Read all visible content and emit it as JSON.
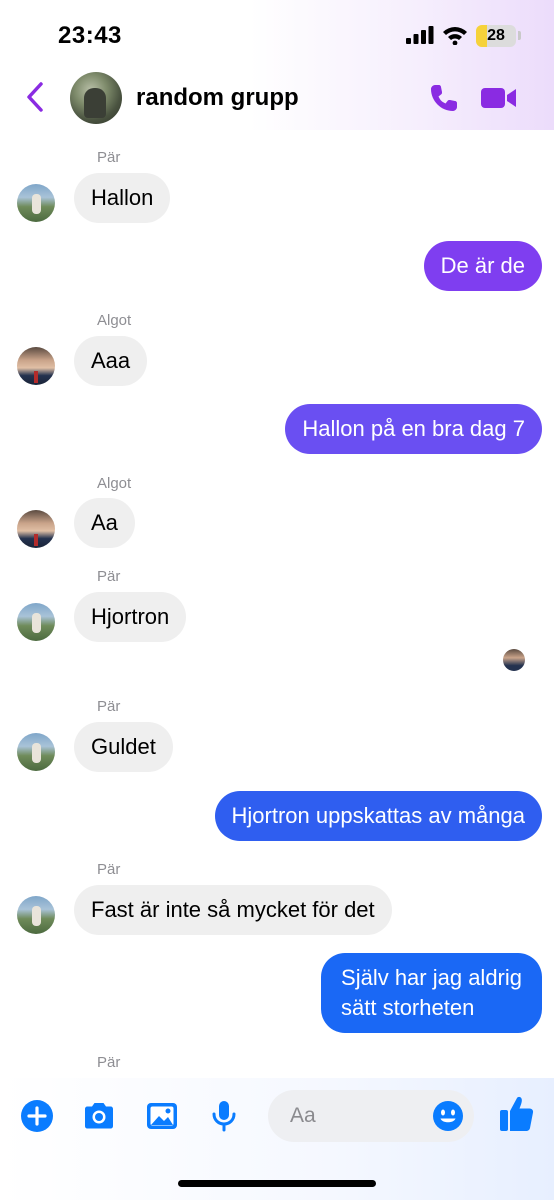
{
  "status_bar": {
    "time": "23:43",
    "battery": "28",
    "battery_level": 0.28
  },
  "header": {
    "title": "random grupp"
  },
  "colors": {
    "accent_purple": "#8a2be2",
    "accent_blue": "#0a7cff"
  },
  "messages": [
    {
      "sender": "Pär",
      "text": "Hallon",
      "direction": "in"
    },
    {
      "text": "De är de",
      "direction": "out"
    },
    {
      "sender": "Algot",
      "text": "Aaa",
      "direction": "in"
    },
    {
      "text": "Hallon på en bra dag 7",
      "direction": "out"
    },
    {
      "sender": "Algot",
      "text": "Aa",
      "direction": "in"
    },
    {
      "sender": "Pär",
      "text": "Hjortron",
      "direction": "in"
    },
    {
      "sender": "Pär",
      "text": "Guldet",
      "direction": "in"
    },
    {
      "text": "Hjortron uppskattas av många",
      "direction": "out"
    },
    {
      "sender": "Pär",
      "text": "Fast är inte så mycket för det",
      "direction": "in"
    },
    {
      "text_lines": [
        "Själv har jag aldrig",
        "sätt storheten"
      ],
      "direction": "out"
    },
    {
      "sender": "Pär"
    }
  ],
  "composer": {
    "placeholder": "Aa"
  },
  "icons": [
    "back-chevron-icon",
    "phone-icon",
    "video-camera-icon",
    "plus-icon",
    "camera-icon",
    "image-icon",
    "microphone-icon",
    "emoji-icon",
    "thumbs-up-icon"
  ]
}
